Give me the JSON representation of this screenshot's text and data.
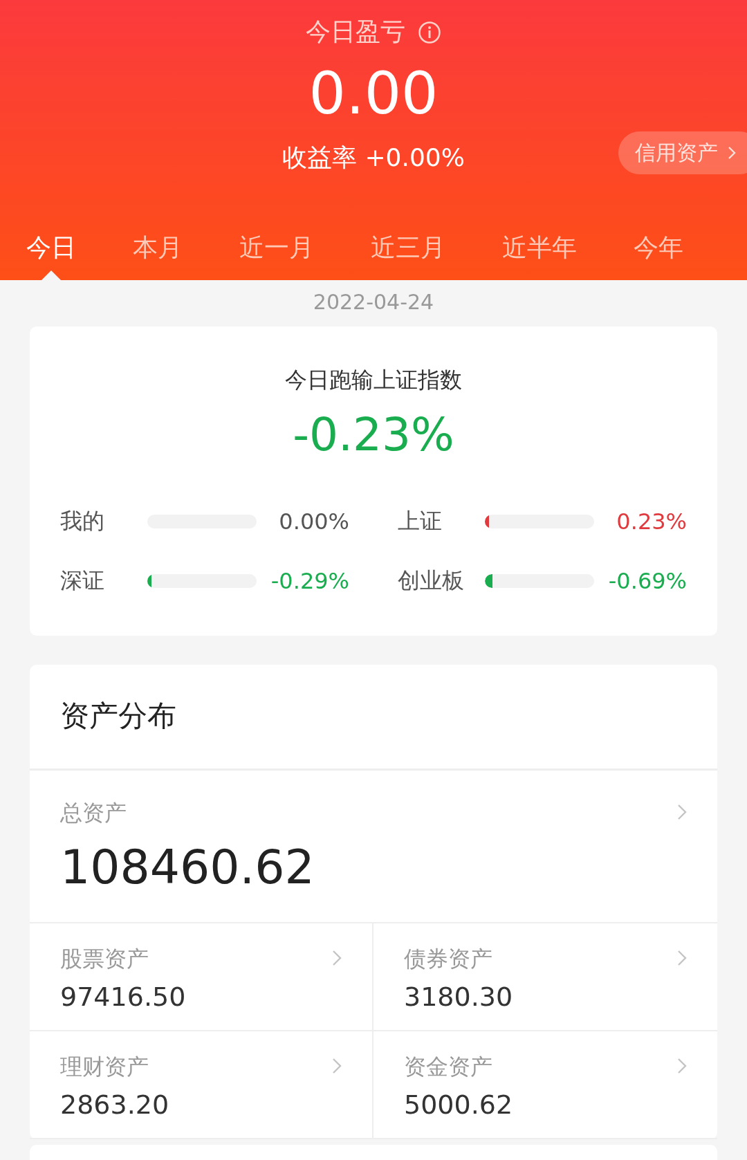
{
  "header": {
    "title": "今日盈亏",
    "amount": "0.00",
    "yield": "收益率 +0.00%",
    "credit_button": "信用资产"
  },
  "tabs": [
    {
      "label": "今日",
      "selected": true
    },
    {
      "label": "本月",
      "selected": false
    },
    {
      "label": "近一月",
      "selected": false
    },
    {
      "label": "近三月",
      "selected": false
    },
    {
      "label": "近半年",
      "selected": false
    },
    {
      "label": "今年",
      "selected": false
    }
  ],
  "date": "2022-04-24",
  "comparison": {
    "title": "今日跑输上证指数",
    "value": "-0.23%",
    "color": "#1aad4f",
    "indices": [
      {
        "name": "我的",
        "level": 0,
        "reading": "0.00%",
        "color": "#555555"
      },
      {
        "name": "上证",
        "level": 0.02,
        "reading": "0.23%",
        "color": "#e03a3e"
      },
      {
        "name": "深证",
        "level": 0.03,
        "reading": "-0.29%",
        "color": "#1aad4f"
      },
      {
        "name": "创业板",
        "level": 0.07,
        "reading": "-0.69%",
        "color": "#1aad4f"
      }
    ]
  },
  "assets": {
    "title": "资产分布",
    "total_label": "总资产",
    "total_value": "108460.62",
    "items": [
      {
        "label": "股票资产",
        "value": "97416.50"
      },
      {
        "label": "债券资产",
        "value": "3180.30"
      },
      {
        "label": "理财资产",
        "value": "2863.20"
      },
      {
        "label": "资金资产",
        "value": "5000.62"
      }
    ]
  }
}
